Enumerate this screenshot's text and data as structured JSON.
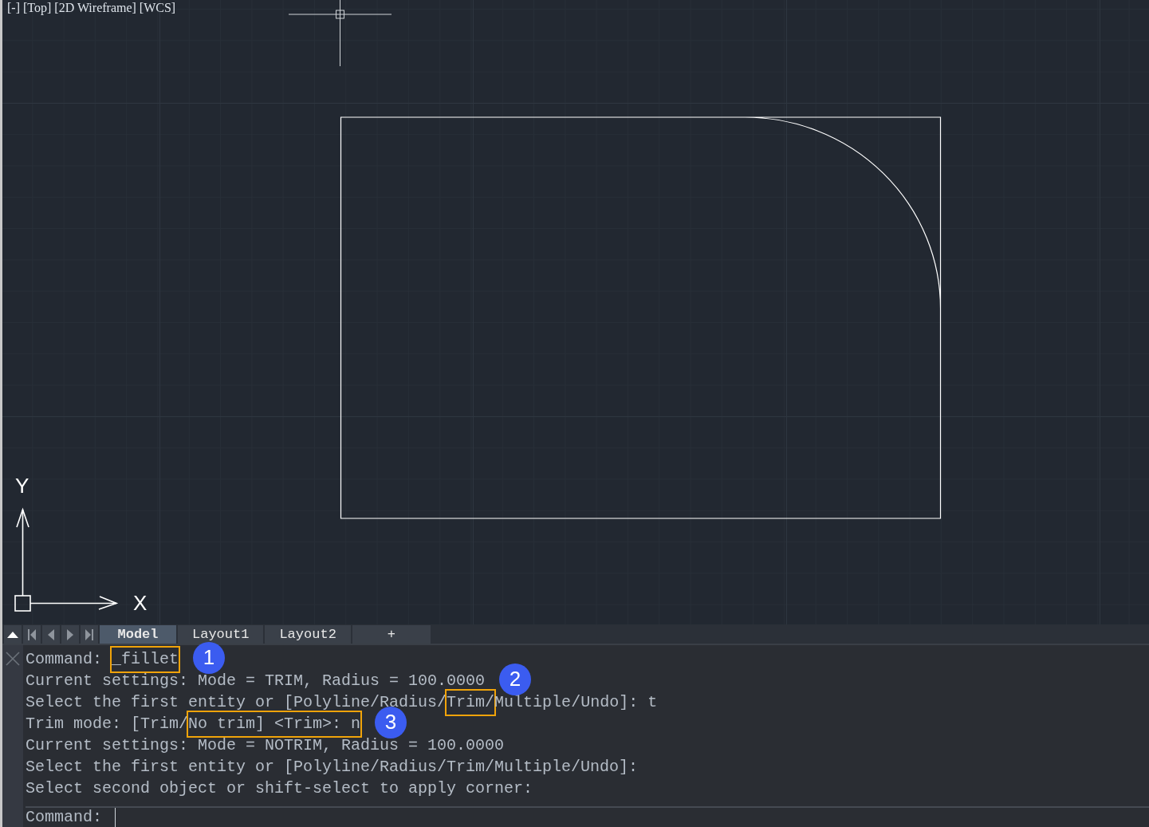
{
  "viewport": {
    "labels": [
      "[-]",
      "[Top]",
      "[2D Wireframe]",
      "[WCS]"
    ]
  },
  "ucs": {
    "x_label": "X",
    "y_label": "Y"
  },
  "tabs": [
    {
      "label": "Model",
      "selected": true
    },
    {
      "label": "Layout1",
      "selected": false
    },
    {
      "label": "Layout2",
      "selected": false
    },
    {
      "label": "+",
      "selected": false
    }
  ],
  "command_history": [
    {
      "parts": [
        {
          "text": "Command: ",
          "highlighted": false
        },
        {
          "text": "_fillet",
          "highlighted": true
        }
      ],
      "callout": "1"
    },
    {
      "parts": [
        {
          "text": "Current settings: Mode = TRIM, Radius = 100.0000",
          "highlighted": false
        }
      ],
      "callout": "2"
    },
    {
      "parts": [
        {
          "text": "Select the first entity or [Polyline/Radius/",
          "highlighted": false
        },
        {
          "text": "Trim/",
          "highlighted": true
        },
        {
          "text": "Multiple/Undo]: t",
          "highlighted": false
        }
      ]
    },
    {
      "parts": [
        {
          "text": "Trim mode: [Trim/",
          "highlighted": false
        },
        {
          "text": "No trim] <Trim>: n",
          "highlighted": true
        }
      ],
      "callout": "3"
    },
    {
      "parts": [
        {
          "text": "Current settings: Mode = NOTRIM, Radius = 100.0000",
          "highlighted": false
        }
      ]
    },
    {
      "parts": [
        {
          "text": "Select the first entity or [Polyline/Radius/Trim/Multiple/Undo]:",
          "highlighted": false
        }
      ]
    },
    {
      "parts": [
        {
          "text": "Select second object or shift-select to apply corner:",
          "highlighted": false
        }
      ]
    }
  ],
  "command_input": {
    "prompt": "Command:"
  }
}
